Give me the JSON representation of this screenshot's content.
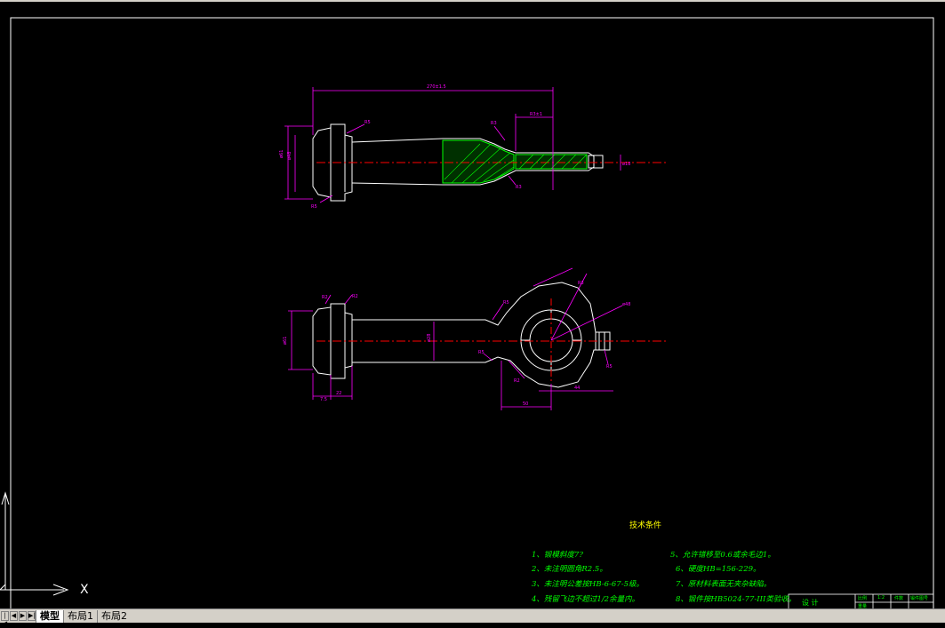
{
  "tabs": {
    "model": "模型",
    "layout1": "布局1",
    "layout2": "布局2"
  },
  "requirements": {
    "title": "技术条件",
    "items": [
      "1、锻模斜度7?",
      "2、未注明圆角R2.5。",
      "3、未注明公差按HB-6-67-5级。",
      "4、残留飞边不超过1/2余量内。",
      "5、允许错移至0.6或余毛边1。",
      "6、硬度HB=156-229。",
      "7、原材料表面无夹杂缺陷。",
      "8、锻件按HB5024-77-III类验收。"
    ]
  },
  "title_block": {
    "designer": "设 计",
    "c1": "比例",
    "c2": "1:2",
    "c3": "件数",
    "c4": "锻件图号",
    "c5": "重量"
  },
  "ucs": {
    "x_label": "X"
  },
  "colors": {
    "background": "#000000",
    "geometry": "#ffffff",
    "dimension": "#ff00ff",
    "centerline": "#ff0000",
    "hatch": "#00ff00",
    "text": "#00ff00",
    "yellow": "#ffff00"
  }
}
